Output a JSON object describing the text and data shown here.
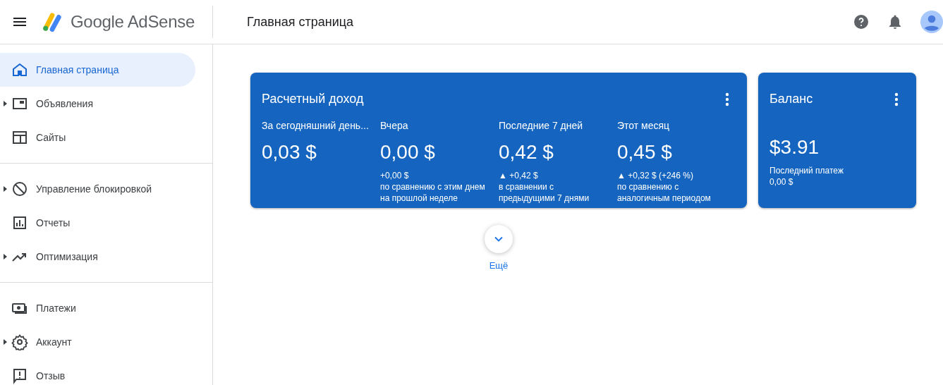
{
  "header": {
    "brand": "Google AdSense",
    "page_title": "Главная страница"
  },
  "sidebar": {
    "groups": [
      {
        "items": [
          {
            "label": "Главная страница",
            "selected": true,
            "expandable": false
          },
          {
            "label": "Объявления",
            "selected": false,
            "expandable": true
          },
          {
            "label": "Сайты",
            "selected": false,
            "expandable": false
          }
        ]
      },
      {
        "items": [
          {
            "label": "Управление блокировкой",
            "selected": false,
            "expandable": true
          },
          {
            "label": "Отчеты",
            "selected": false,
            "expandable": false
          },
          {
            "label": "Оптимизация",
            "selected": false,
            "expandable": true
          }
        ]
      },
      {
        "items": [
          {
            "label": "Платежи",
            "selected": false,
            "expandable": false
          },
          {
            "label": "Аккаунт",
            "selected": false,
            "expandable": true
          },
          {
            "label": "Отзыв",
            "selected": false,
            "expandable": false
          }
        ]
      }
    ]
  },
  "earnings_card": {
    "title": "Расчетный доход",
    "metrics": [
      {
        "label": "За сегодняшний день...",
        "value": "0,03 $"
      },
      {
        "label": "Вчера",
        "value": "0,00 $",
        "change": "+0,00 $",
        "comparison": "по сравнению с этим днем на прошлой неделе"
      },
      {
        "label": "Последние 7 дней",
        "value": "0,42 $",
        "change": "▲ +0,42 $",
        "comparison": "в сравнении с предыдущими 7 днями"
      },
      {
        "label": "Этот месяц",
        "value": "0,45 $",
        "change": "▲ +0,32 $ (+246 %)",
        "comparison": "по сравнению с аналогичным периодом"
      }
    ]
  },
  "balance_card": {
    "title": "Баланс",
    "value": "$3.91",
    "last_payment_label": "Последний платеж",
    "last_payment_value": "0,00 $"
  },
  "more_button": {
    "label": "Ещё"
  }
}
